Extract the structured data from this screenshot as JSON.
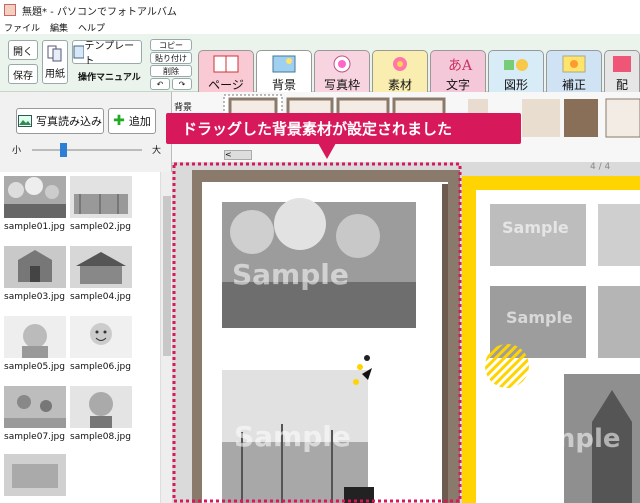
{
  "window": {
    "title": "無題* - パソコンでフォトアルバム"
  },
  "menu": [
    "ファイル",
    "編集",
    "ヘルプ"
  ],
  "toolbar": {
    "open": "開く",
    "save": "保存",
    "paper": "用紙",
    "template": "テンプレート",
    "manual": "操作マニュアル",
    "copy": "コピー",
    "paste": "貼り付け",
    "delete": "削除",
    "undo": "↶",
    "redo": "↷"
  },
  "tabs": [
    "ページ",
    "背景",
    "写真枠",
    "素材",
    "文字",
    "図形",
    "補正",
    "配"
  ],
  "active_tab": "背景",
  "left_panel": {
    "load_button": "写真読み込み",
    "add_button": "追加",
    "size_small": "小",
    "size_large": "大",
    "slider_level": 0.28,
    "thumbnails": [
      "sample01.jpg",
      "sample02.jpg",
      "sample03.jpg",
      "sample04.jpg",
      "sample05.jpg",
      "sample06.jpg",
      "sample07.jpg",
      "sample08.jpg"
    ]
  },
  "background_strip": {
    "label": "背景",
    "scroll_label": "<"
  },
  "tooltip": "ドラッグした背景素材が設定されました",
  "canvas": {
    "page_counter": "4 / 4",
    "watermark": "Sample"
  },
  "colors": {
    "accent": "#d7185b",
    "frame_brown": "#8a7a6b",
    "yellow_border": "#ffd400",
    "ribbon_bg": "#eaf4ec"
  }
}
